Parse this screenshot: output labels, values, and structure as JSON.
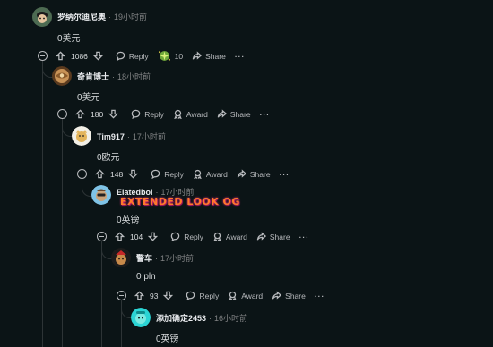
{
  "colors": {
    "background": "#0b1416",
    "text": "#d7dadc",
    "muted": "#818384",
    "thread_line": "#2d3436",
    "flair": "#ff7a2a"
  },
  "comments": [
    {
      "username": "罗纳尔迪尼奥",
      "time": "19小时前",
      "text": "0美元",
      "score": "1086",
      "reply_label": "Reply",
      "award_count": "10",
      "share_label": "Share",
      "more_label": "···"
    },
    {
      "username": "奇肯博士",
      "time": "18小时前",
      "text": "0美元",
      "score": "180",
      "reply_label": "Reply",
      "award_label": "Award",
      "share_label": "Share",
      "more_label": "···"
    },
    {
      "username": "Tim917",
      "time": "17小时前",
      "text": "0欧元",
      "score": "148",
      "reply_label": "Reply",
      "award_label": "Award",
      "share_label": "Share",
      "more_label": "···"
    },
    {
      "username": "Elatedboi",
      "time": "17小时前",
      "flair": "EXTENDED LOOK OG",
      "text": "0英镑",
      "score": "104",
      "reply_label": "Reply",
      "award_label": "Award",
      "share_label": "Share",
      "more_label": "···"
    },
    {
      "username": "警车",
      "time": "17小时前",
      "text": "0 pln",
      "score": "93",
      "reply_label": "Reply",
      "award_label": "Award",
      "share_label": "Share",
      "more_label": "···"
    },
    {
      "username": "添加确定2453",
      "time": "16小时前",
      "text": "0英镑"
    }
  ]
}
